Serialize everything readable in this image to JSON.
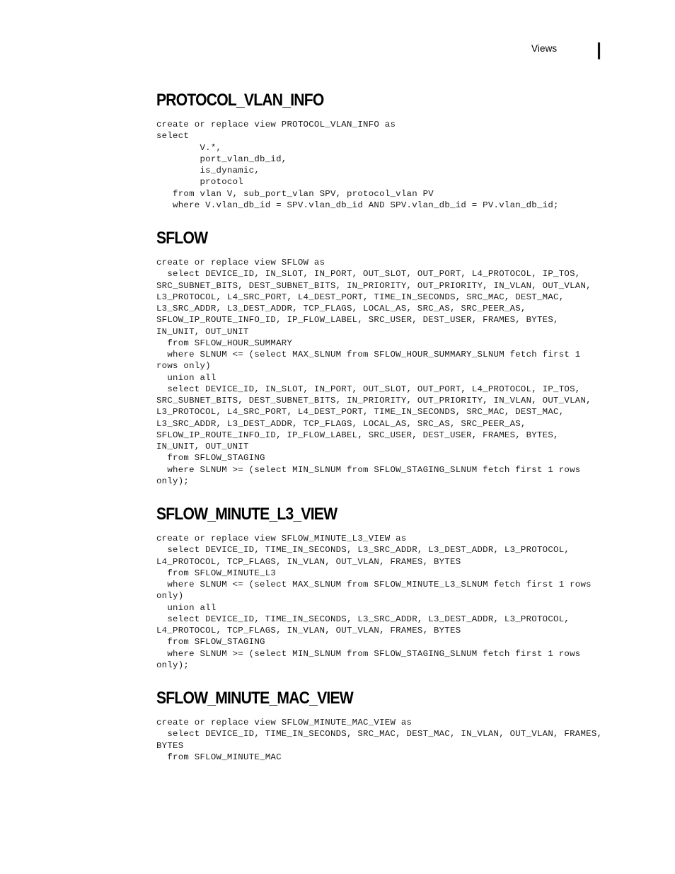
{
  "header": {
    "chapter_label": "Views",
    "page_mark": "|"
  },
  "sections": [
    {
      "id": "protocol-vlan-info",
      "title": "PROTOCOL_VLAN_INFO",
      "sql": "create or replace view PROTOCOL_VLAN_INFO as\nselect\n        V.*,\n        port_vlan_db_id,\n        is_dynamic,\n        protocol\n   from vlan V, sub_port_vlan SPV, protocol_vlan PV\n   where V.vlan_db_id = SPV.vlan_db_id AND SPV.vlan_db_id = PV.vlan_db_id;"
    },
    {
      "id": "sflow",
      "title": "SFLOW",
      "sql": "create or replace view SFLOW as\n  select DEVICE_ID, IN_SLOT, IN_PORT, OUT_SLOT, OUT_PORT, L4_PROTOCOL, IP_TOS,\nSRC_SUBNET_BITS, DEST_SUBNET_BITS, IN_PRIORITY, OUT_PRIORITY, IN_VLAN, OUT_VLAN,\nL3_PROTOCOL, L4_SRC_PORT, L4_DEST_PORT, TIME_IN_SECONDS, SRC_MAC, DEST_MAC,\nL3_SRC_ADDR, L3_DEST_ADDR, TCP_FLAGS, LOCAL_AS, SRC_AS, SRC_PEER_AS,\nSFLOW_IP_ROUTE_INFO_ID, IP_FLOW_LABEL, SRC_USER, DEST_USER, FRAMES, BYTES,\nIN_UNIT, OUT_UNIT\n  from SFLOW_HOUR_SUMMARY\n  where SLNUM <= (select MAX_SLNUM from SFLOW_HOUR_SUMMARY_SLNUM fetch first 1\nrows only)\n  union all\n  select DEVICE_ID, IN_SLOT, IN_PORT, OUT_SLOT, OUT_PORT, L4_PROTOCOL, IP_TOS,\nSRC_SUBNET_BITS, DEST_SUBNET_BITS, IN_PRIORITY, OUT_PRIORITY, IN_VLAN, OUT_VLAN,\nL3_PROTOCOL, L4_SRC_PORT, L4_DEST_PORT, TIME_IN_SECONDS, SRC_MAC, DEST_MAC,\nL3_SRC_ADDR, L3_DEST_ADDR, TCP_FLAGS, LOCAL_AS, SRC_AS, SRC_PEER_AS,\nSFLOW_IP_ROUTE_INFO_ID, IP_FLOW_LABEL, SRC_USER, DEST_USER, FRAMES, BYTES,\nIN_UNIT, OUT_UNIT\n  from SFLOW_STAGING\n  where SLNUM >= (select MIN_SLNUM from SFLOW_STAGING_SLNUM fetch first 1 rows\nonly);"
    },
    {
      "id": "sflow-minute-l3-view",
      "title": "SFLOW_MINUTE_L3_VIEW",
      "sql": "create or replace view SFLOW_MINUTE_L3_VIEW as\n  select DEVICE_ID, TIME_IN_SECONDS, L3_SRC_ADDR, L3_DEST_ADDR, L3_PROTOCOL,\nL4_PROTOCOL, TCP_FLAGS, IN_VLAN, OUT_VLAN, FRAMES, BYTES\n  from SFLOW_MINUTE_L3\n  where SLNUM <= (select MAX_SLNUM from SFLOW_MINUTE_L3_SLNUM fetch first 1 rows\nonly)\n  union all\n  select DEVICE_ID, TIME_IN_SECONDS, L3_SRC_ADDR, L3_DEST_ADDR, L3_PROTOCOL,\nL4_PROTOCOL, TCP_FLAGS, IN_VLAN, OUT_VLAN, FRAMES, BYTES\n  from SFLOW_STAGING\n  where SLNUM >= (select MIN_SLNUM from SFLOW_STAGING_SLNUM fetch first 1 rows\nonly);"
    },
    {
      "id": "sflow-minute-mac-view",
      "title": "SFLOW_MINUTE_MAC_VIEW",
      "sql": "create or replace view SFLOW_MINUTE_MAC_VIEW as\n  select DEVICE_ID, TIME_IN_SECONDS, SRC_MAC, DEST_MAC, IN_VLAN, OUT_VLAN, FRAMES,\nBYTES\n  from SFLOW_MINUTE_MAC"
    }
  ]
}
